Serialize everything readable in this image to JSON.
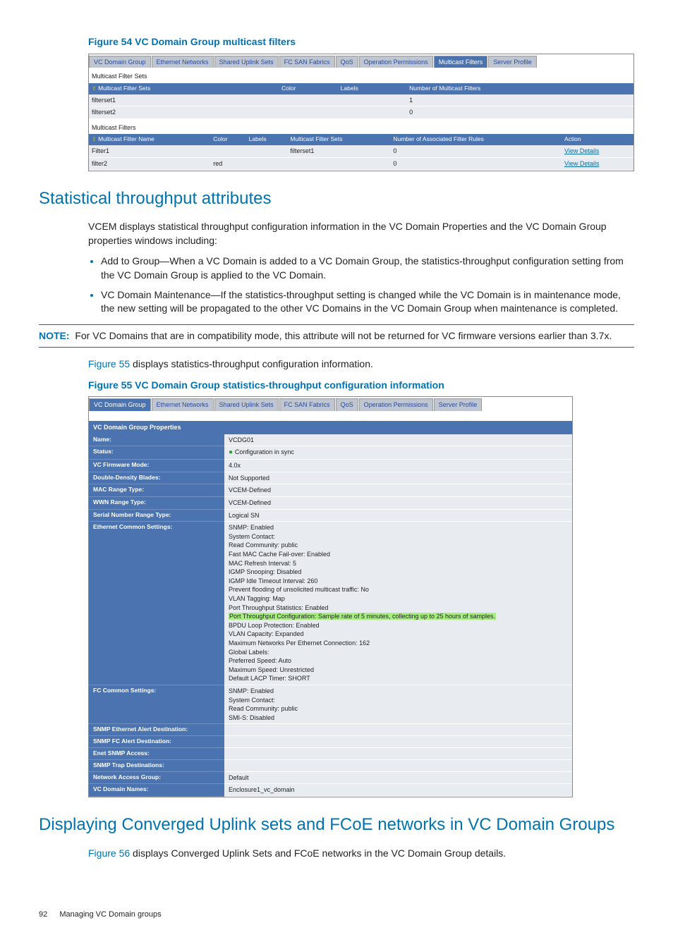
{
  "figure54": {
    "title": "Figure 54 VC Domain Group multicast filters",
    "tabs": [
      "VC Domain Group",
      "Ethernet Networks",
      "Shared Uplink Sets",
      "FC SAN Fabrics",
      "QoS",
      "Operation Permissions",
      "Multicast Filters",
      "Server Profile"
    ],
    "active_tab_index": 6,
    "sets_label": "Multicast Filter Sets",
    "sets_headers": [
      "Multicast Filter Sets",
      "Color",
      "Labels",
      "Number of Multicast Filters"
    ],
    "sets_rows": [
      {
        "name": "filterset1",
        "color": "",
        "labels": "",
        "num": "1"
      },
      {
        "name": "filterset2",
        "color": "",
        "labels": "",
        "num": "0"
      }
    ],
    "filters_label": "Multicast Filters",
    "filters_headers": [
      "Multicast Filter Name",
      "Color",
      "Labels",
      "Multicast Filter Sets",
      "Number of Associated Filter Rules",
      "Action"
    ],
    "filters_rows": [
      {
        "name": "Filter1",
        "color": "",
        "labels": "",
        "sets": "filterset1",
        "rules": "0",
        "action": "View Details"
      },
      {
        "name": "filter2",
        "color": "red",
        "labels": "",
        "sets": "",
        "rules": "0",
        "action": "View Details"
      }
    ]
  },
  "section1": {
    "title": "Statistical throughput attributes",
    "para": "VCEM displays statistical throughput configuration information in the VC Domain Properties and the VC Domain Group properties windows including:",
    "bullets": [
      "Add to Group—When a VC Domain is added to a VC Domain Group, the statistics-throughput configuration setting from the VC Domain Group is applied to the VC Domain.",
      "VC Domain Maintenance—If the statistics-throughput setting is changed while the VC Domain is in maintenance mode, the new setting will be propagated to the other VC Domains in the VC Domain Group when maintenance is completed."
    ],
    "note_label": "NOTE:",
    "note_text": "For VC Domains that are in compatibility mode, this attribute will not be returned for VC firmware versions earlier than 3.7x.",
    "after_note_link": "Figure 55",
    "after_note_text": " displays statistics-throughput configuration information."
  },
  "figure55": {
    "title": "Figure 55 VC Domain Group statistics-throughput configuration information",
    "tabs": [
      "VC Domain Group",
      "Ethernet Networks",
      "Shared Uplink Sets",
      "FC SAN Fabrics",
      "QoS",
      "Operation Permissions",
      "Server Profile"
    ],
    "active_tab_index": 0,
    "props_title": "VC Domain Group Properties",
    "rows": [
      {
        "lbl": "Name:",
        "val": "VCDG01"
      },
      {
        "lbl": "Status:",
        "val": "Configuration in sync",
        "icon": true
      },
      {
        "lbl": "VC Firmware Mode:",
        "val": "4.0x"
      },
      {
        "lbl": "Double-Density Blades:",
        "val": "Not Supported"
      },
      {
        "lbl": "MAC Range Type:",
        "val": "VCEM-Defined"
      },
      {
        "lbl": "WWN Range Type:",
        "val": "VCEM-Defined"
      },
      {
        "lbl": "Serial Number Range Type:",
        "val": "Logical SN"
      },
      {
        "lbl": "Ethernet Common Settings:",
        "val_lines": [
          "SNMP: Enabled",
          "System Contact:",
          "Read Community: public",
          "Fast MAC Cache Fail-over: Enabled",
          "MAC Refresh Interval: 5",
          "IGMP Snooping: Disabled",
          "IGMP Idle Timeout Interval: 260",
          "Prevent flooding of unsolicited multicast traffic: No",
          "VLAN Tagging: Map",
          "Port Throughput Statistics: Enabled",
          {
            "hl": "Port Throughput Configuration: Sample rate of 5 minutes, collecting up to 25 hours of samples."
          },
          "BPDU Loop Protection: Enabled",
          "VLAN Capacity: Expanded",
          "Maximum Networks Per Ethernet Connection: 162",
          "Global Labels:",
          "Preferred Speed: Auto",
          "Maximum Speed: Unrestricted",
          "Default LACP Timer: SHORT"
        ]
      },
      {
        "lbl": "FC Common Settings:",
        "val_lines": [
          "SNMP: Enabled",
          "System Contact:",
          "Read Community: public",
          "SMI-S: Disabled"
        ]
      },
      {
        "lbl": "SNMP Ethernet Alert Destination:",
        "val": ""
      },
      {
        "lbl": "SNMP FC Alert Destination:",
        "val": ""
      },
      {
        "lbl": "Enet SNMP Access:",
        "val": ""
      },
      {
        "lbl": "SNMP Trap Destinations:",
        "val": ""
      },
      {
        "lbl": "Network Access Group:",
        "val": "Default"
      },
      {
        "lbl": "VC Domain Names:",
        "val": "Enclosure1_vc_domain"
      }
    ]
  },
  "section2": {
    "title": "Displaying Converged Uplink sets and FCoE networks in VC Domain Groups",
    "link": "Figure 56",
    "para": " displays Converged Uplink Sets and FCoE networks in the VC Domain Group details."
  },
  "footer": {
    "page": "92",
    "chapter": "Managing VC Domain groups"
  }
}
